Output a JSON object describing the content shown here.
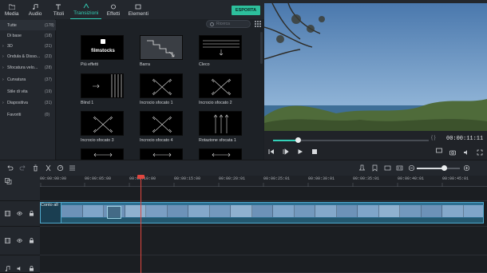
{
  "library_tabs": [
    {
      "label": "Media",
      "icon": "folder-icon"
    },
    {
      "label": "Audio",
      "icon": "music-note-icon"
    },
    {
      "label": "Titoli",
      "icon": "text-icon"
    },
    {
      "label": "Transizioni",
      "icon": "transition-icon",
      "active": true
    },
    {
      "label": "Effetti",
      "icon": "effects-icon"
    },
    {
      "label": "Elementi",
      "icon": "image-icon"
    }
  ],
  "export_label": "ESPORTA",
  "search_placeholder": "Ricerca",
  "categories": [
    {
      "name": "Tutte",
      "count": "(178)",
      "expandable": false,
      "selected": true
    },
    {
      "name": "Di base",
      "count": "(18)",
      "expandable": false
    },
    {
      "name": "3D",
      "count": "(21)",
      "expandable": true
    },
    {
      "name": "Ondula & Disso...",
      "count": "(23)",
      "expandable": true
    },
    {
      "name": "Sfocatura velo...",
      "count": "(28)",
      "expandable": true
    },
    {
      "name": "Curvatura",
      "count": "(37)",
      "expandable": true
    },
    {
      "name": "Stile di vita",
      "count": "(19)",
      "expandable": false
    },
    {
      "name": "Diapositiva",
      "count": "(31)",
      "expandable": true
    },
    {
      "name": "Favoriti",
      "count": "(0)",
      "expandable": false
    }
  ],
  "transitions": [
    {
      "label": "Più effetti",
      "kind": "filmstocks",
      "brand": "filmstocks"
    },
    {
      "label": "Barra",
      "kind": "barra"
    },
    {
      "label": "Cleco",
      "kind": "cleco"
    },
    {
      "label": "Blind 1",
      "kind": "blind"
    },
    {
      "label": "Incrocio sfocato 1",
      "kind": "cross"
    },
    {
      "label": "Incrocio sfocato 2",
      "kind": "cross"
    },
    {
      "label": "Incrocio sfocato 3",
      "kind": "cross"
    },
    {
      "label": "Incrocio sfocato 4",
      "kind": "cross"
    },
    {
      "label": "Rotazione sfocata 1",
      "kind": "rotate"
    }
  ],
  "preview": {
    "timecode": "00:00:11:11",
    "brackets": "{   }",
    "progress": 0.16
  },
  "zoom_level": 0.63,
  "timeline": {
    "timecodes": [
      "00:00:00:00",
      "00:00:05:00",
      "00:00:10:00",
      "00:00:15:00",
      "00:00:20:01",
      "00:00:25:01",
      "00:00:30:01",
      "00:00:35:01",
      "00:00:40:01",
      "00:00:45:01"
    ],
    "clip_title": "Conto all"
  },
  "colors": {
    "accent": "#33d1b8",
    "export": "#2dbf9c",
    "clip": "#2d6f91",
    "playhead": "#e0463f"
  }
}
